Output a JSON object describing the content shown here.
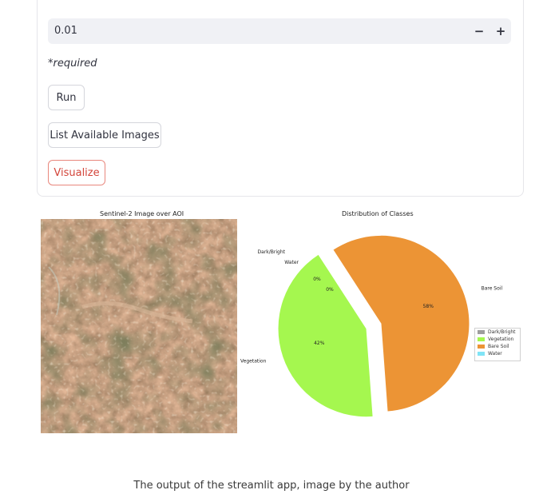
{
  "form": {
    "threshold_value": "0.01",
    "decrement_label": "−",
    "increment_label": "+",
    "required_note": "*required",
    "run_label": "Run",
    "list_images_label": "List Available Images",
    "visualize_label": "Visualize"
  },
  "image_panel": {
    "title": "Sentinel-2 Image over AOI"
  },
  "chart_data": {
    "type": "pie",
    "title": "Distribution of Classes",
    "slices": [
      {
        "label": "Bare Soil",
        "value": 58,
        "pct_label": "58%",
        "color": "#ec9435"
      },
      {
        "label": "Vegetation",
        "value": 42,
        "pct_label": "42%",
        "color": "#a5f74f"
      },
      {
        "label": "Water",
        "value": 0,
        "pct_label": "0%",
        "color": "#80e4f6"
      },
      {
        "label": "Dark/Bright",
        "value": 0,
        "pct_label": "0%",
        "color": "#9e9e9e"
      }
    ],
    "legend": {
      "position": "right",
      "entries": [
        "Dark/Bright",
        "Vegetation",
        "Bare Soil",
        "Water"
      ]
    }
  },
  "caption": "The output of the streamlit app, image by the author"
}
